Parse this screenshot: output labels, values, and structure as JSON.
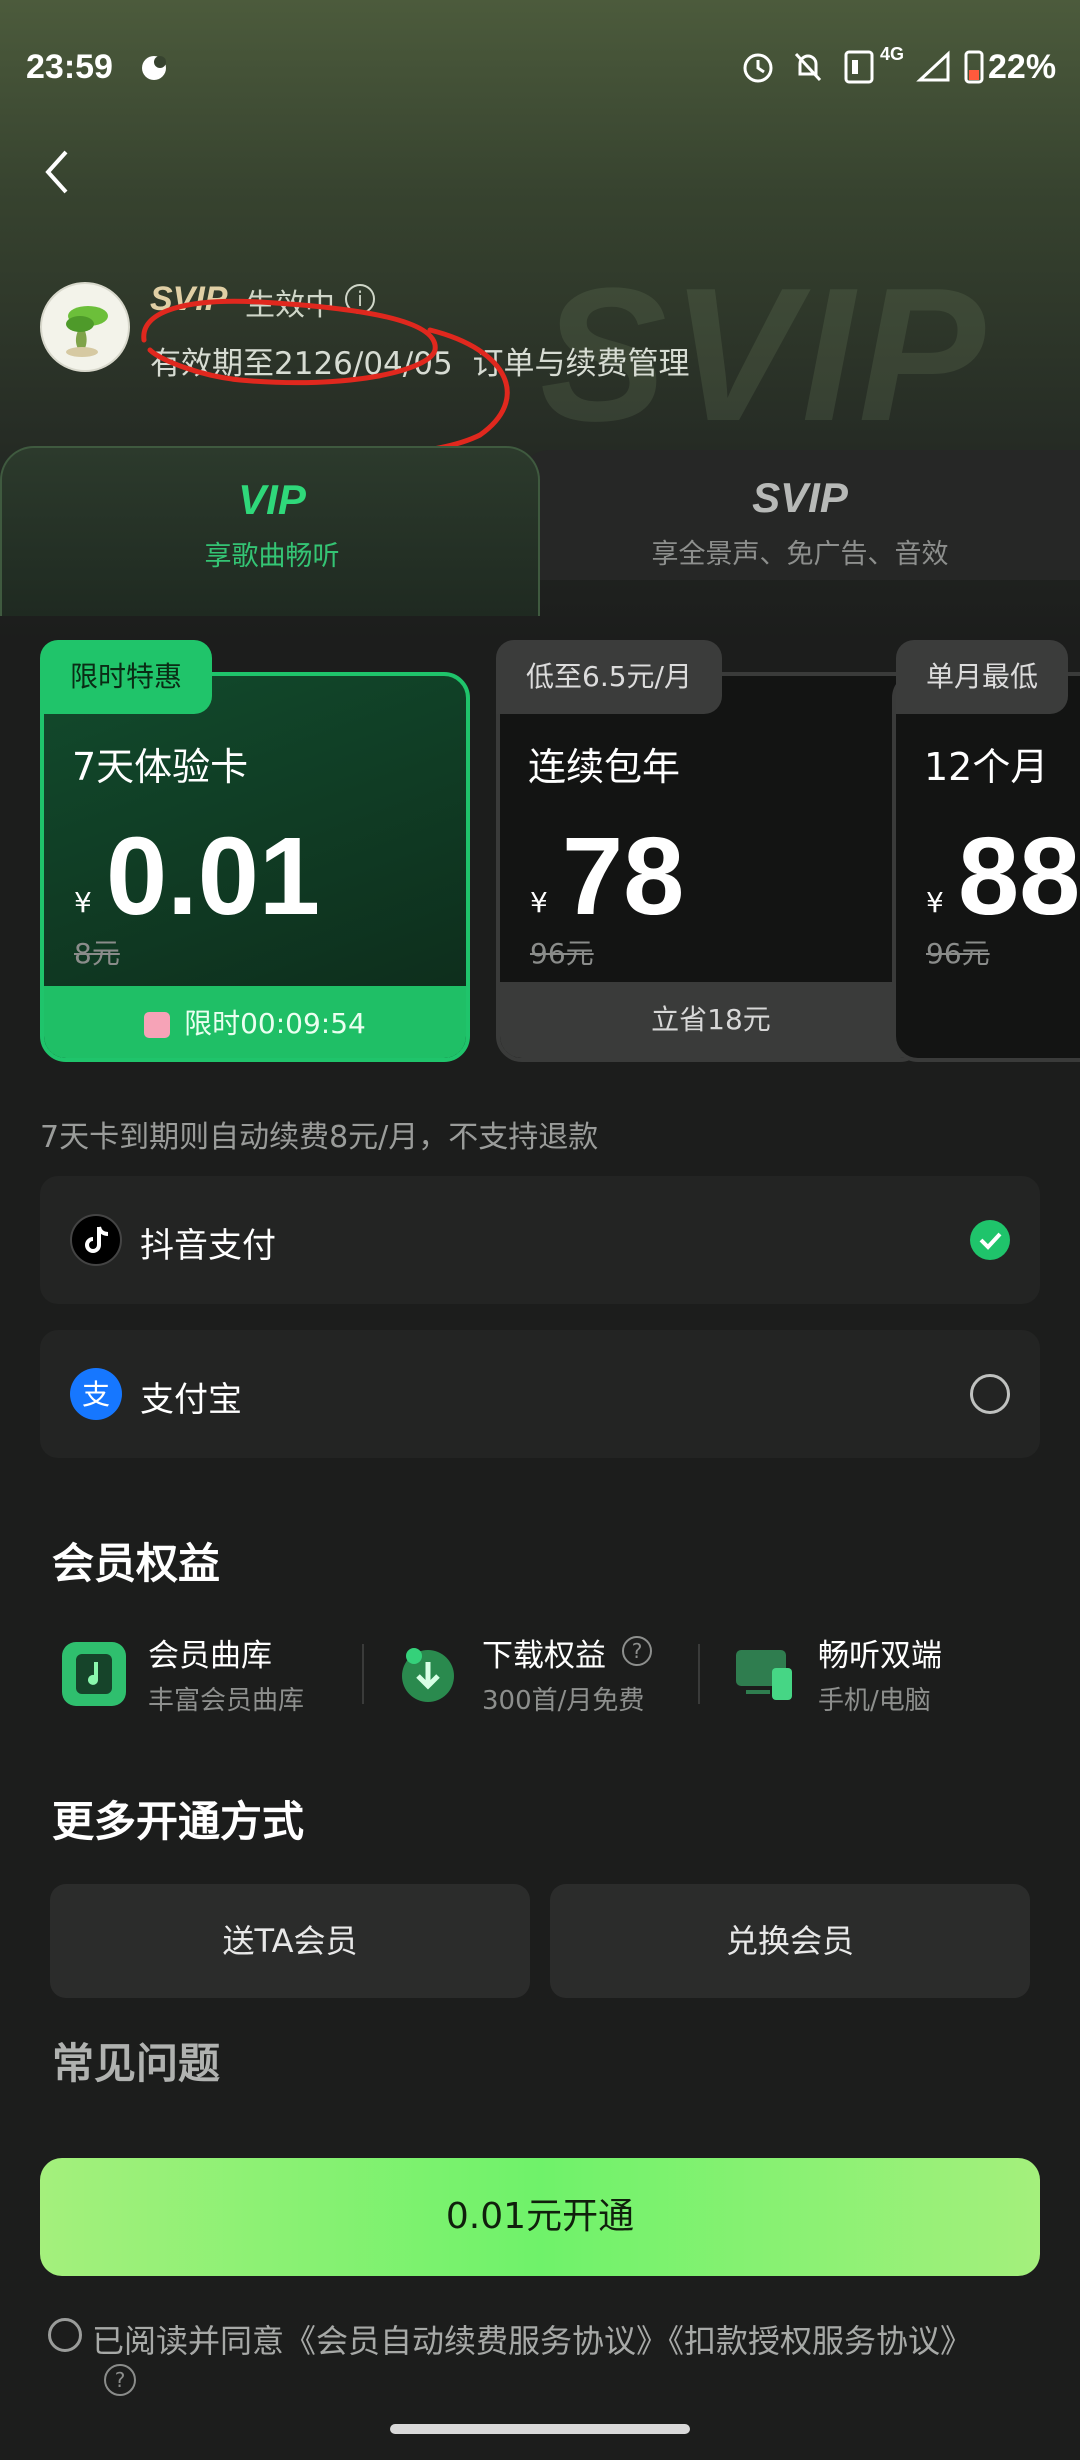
{
  "status_bar": {
    "time": "23:59",
    "network": "4G",
    "battery": "22%"
  },
  "watermark": "SVIP",
  "member": {
    "level": "SVIP",
    "status": "生效中",
    "expire": "有效期至2126/04/05",
    "manage_link": "订单与续费管理"
  },
  "tabs": [
    {
      "title": "VIP",
      "subtitle": "享歌曲畅听"
    },
    {
      "title": "SVIP",
      "subtitle": "享全景声、免广告、音效"
    }
  ],
  "products": [
    {
      "tag": "限时特惠",
      "name": "7天体验卡",
      "currency": "¥",
      "price": "0.01",
      "original": "8元",
      "footer": "限时00:09:54"
    },
    {
      "tag": "低至6.5元/月",
      "name": "连续包年",
      "currency": "¥",
      "price": "78",
      "original": "96元",
      "footer": "立省18元"
    },
    {
      "tag": "单月最低",
      "name": "12个月",
      "currency": "¥",
      "price": "88",
      "original": "96元",
      "footer": ""
    }
  ],
  "auto_renew_note": "7天卡到期则自动续费8元/月，不支持退款",
  "payments": [
    {
      "label": "抖音支付",
      "selected": true
    },
    {
      "label": "支付宝",
      "selected": false
    }
  ],
  "benefits": {
    "title": "会员权益",
    "items": [
      {
        "name": "会员曲库",
        "desc": "丰富会员曲库"
      },
      {
        "name": "下载权益",
        "desc": "300首/月免费"
      },
      {
        "name": "畅听双端",
        "desc": "手机/电脑"
      }
    ]
  },
  "more": {
    "title": "更多开通方式",
    "buttons": [
      "送TA会员",
      "兑换会员"
    ]
  },
  "faq_title": "常见问题",
  "cta_label": "0.01元开通",
  "agreement": "已阅读并同意《会员自动续费服务协议》《扣款授权服务协议》",
  "colors": {
    "accent": "#1fc46b",
    "cta": "#7ff26e",
    "background": "#1c1d1c"
  }
}
